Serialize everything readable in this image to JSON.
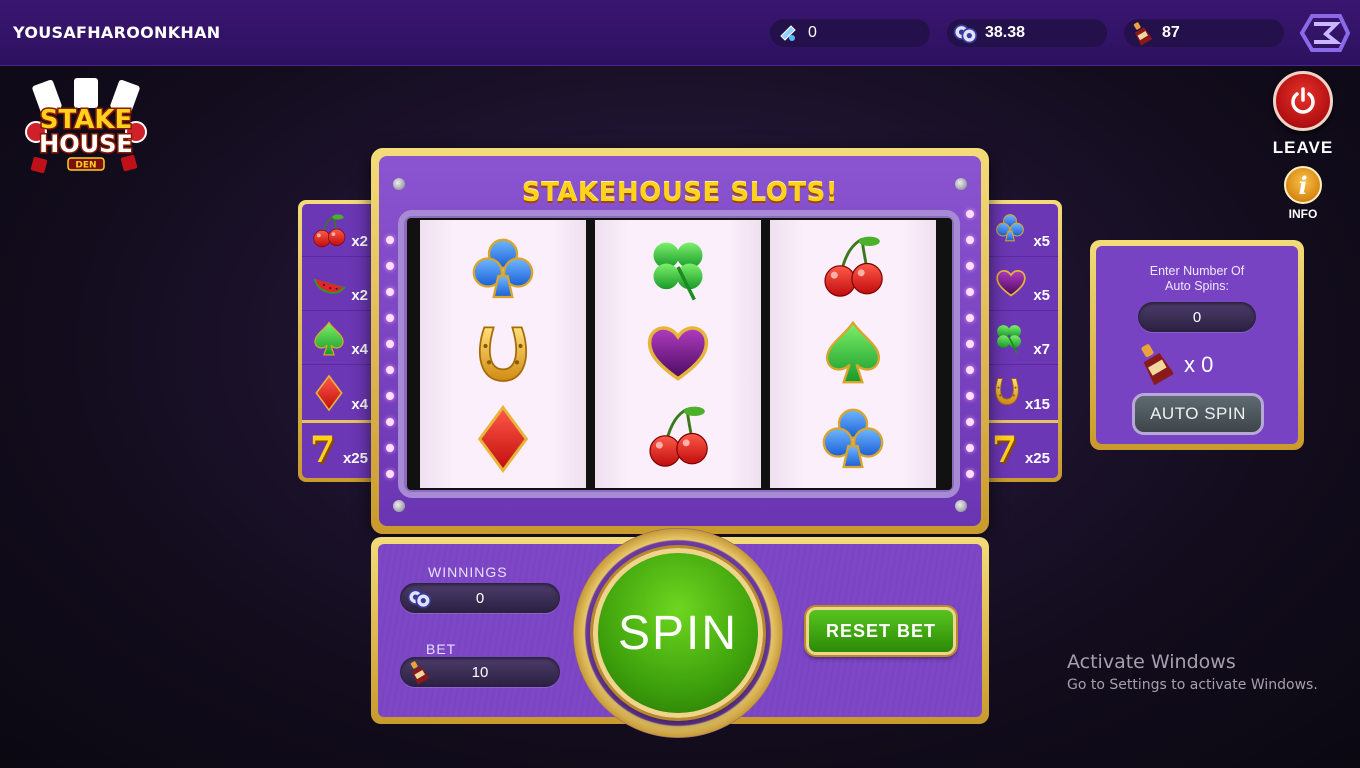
{
  "header": {
    "username": "YOUSAFHAROONKHAN",
    "gems": "0",
    "chips": "38.38",
    "bottles": "87"
  },
  "logo": {
    "line1": "STAKE",
    "line2": "HOUSE",
    "line3": "DEN"
  },
  "controls": {
    "leave_label": "LEAVE",
    "info_label": "INFO",
    "info_glyph": "i"
  },
  "machine": {
    "title": "STAKEHOUSE SLOTS!",
    "reels": [
      [
        "club-icon",
        "horseshoe-icon",
        "diamond-icon"
      ],
      [
        "clover-icon",
        "heart-icon",
        "cherry-icon"
      ],
      [
        "cherry-icon",
        "spade-icon",
        "club-icon"
      ]
    ]
  },
  "paytable_left": [
    {
      "icon": "cherry-icon",
      "mult": "x2"
    },
    {
      "icon": "watermelon-icon",
      "mult": "x2"
    },
    {
      "icon": "spade-icon",
      "mult": "x4"
    },
    {
      "icon": "diamond-icon",
      "mult": "x4"
    },
    {
      "icon": "seven-icon",
      "mult": "x25"
    }
  ],
  "paytable_right": [
    {
      "icon": "club-icon",
      "mult": "x5"
    },
    {
      "icon": "heart-icon",
      "mult": "x5"
    },
    {
      "icon": "clover-icon",
      "mult": "x7"
    },
    {
      "icon": "horseshoe-icon",
      "mult": "x15"
    },
    {
      "icon": "seven-icon",
      "mult": "x25"
    }
  ],
  "bottom": {
    "winnings_label": "WINNINGS",
    "winnings_value": "0",
    "bet_label": "BET",
    "bet_value": "10",
    "spin_label": "SPIN",
    "reset_label": "RESET BET"
  },
  "auto": {
    "label_line1": "Enter Number Of",
    "label_line2": "Auto Spins:",
    "spins_value": "0",
    "cost_text": "x 0",
    "button_label": "AUTO SPIN"
  },
  "watermark": {
    "title": "Activate Windows",
    "subtitle": "Go to Settings to activate Windows."
  },
  "colors": {
    "topbar": "#2d1160",
    "panel_purple": "#6b37b4",
    "gold": "#e6c45a",
    "spin_green": "#3ea20c",
    "leave_red": "#c8141a"
  }
}
